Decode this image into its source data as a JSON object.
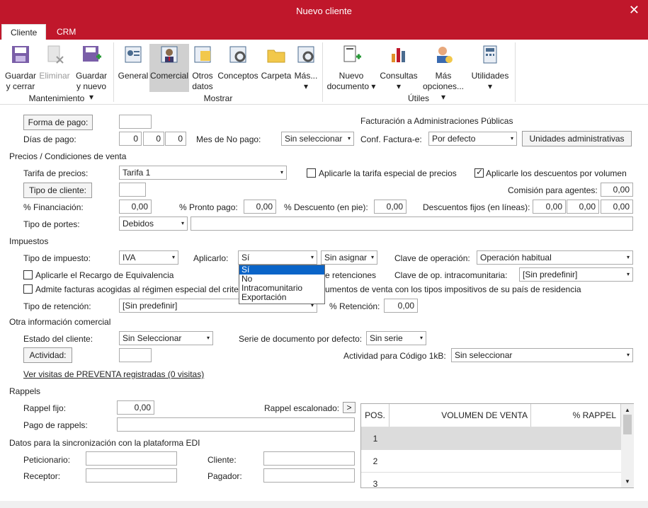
{
  "window": {
    "title": "Nuevo cliente",
    "close": "✕"
  },
  "tabs": [
    {
      "label": "Cliente"
    },
    {
      "label": "CRM"
    }
  ],
  "ribbon": {
    "mantenimiento": {
      "label": "Mantenimiento",
      "guardar_cerrar": "Guardar\ny cerrar",
      "eliminar": "Eliminar",
      "guardar_nuevo": "Guardar\ny nuevo ▾"
    },
    "mostrar": {
      "label": "Mostrar",
      "general": "General",
      "comercial": "Comercial",
      "otros_datos": "Otros\ndatos",
      "conceptos": "Conceptos",
      "carpeta": "Carpeta",
      "mas": "Más...\n▾"
    },
    "utiles": {
      "label": "Útiles",
      "nuevo_documento": "Nuevo\ndocumento ▾",
      "consultas": "Consultas\n▾",
      "mas_opciones": "Más\nopciones... ▾",
      "utilidades": "Utilidades\n▾"
    }
  },
  "pago": {
    "forma_de_pago_btn": "Forma de pago:",
    "forma_de_pago_value": "",
    "dias_de_pago_label": "Días de pago:",
    "dias": [
      "0",
      "0",
      "0"
    ],
    "mes_no_pago_label": "Mes de No pago:",
    "mes_no_pago_value": "Sin seleccionar",
    "facturacion_ap_label": "Facturación a Administraciones Públicas",
    "conf_factura_label": "Conf. Factura-e:",
    "conf_factura_value": "Por defecto",
    "unidades_btn": "Unidades administrativas"
  },
  "precios": {
    "section": "Precios / Condiciones de venta",
    "tarifa_label": "Tarifa de precios:",
    "tarifa_value": "Tarifa 1",
    "tarifa_especial_label": "Aplicarle la tarifa especial de precios",
    "tarifa_especial_checked": false,
    "descuentos_volumen_label": "Aplicarle los descuentos por volumen",
    "descuentos_volumen_checked": true,
    "tipo_cliente_btn": "Tipo de cliente:",
    "tipo_cliente_value": "",
    "comision_label": "Comisión para agentes:",
    "comision_value": "0,00",
    "financiacion_label": "% Financiación:",
    "financiacion_value": "0,00",
    "pronto_pago_label": "% Pronto pago:",
    "pronto_pago_value": "0,00",
    "descuento_pie_label": "% Descuento (en pie):",
    "descuento_pie_value": "0,00",
    "descuentos_fijos_label": "Descuentos fijos (en líneas):",
    "descuentos_fijos": [
      "0,00",
      "0,00",
      "0,00"
    ],
    "tipo_portes_label": "Tipo de portes:",
    "tipo_portes_value": "Debidos",
    "portes_extra": ""
  },
  "impuestos": {
    "section": "Impuestos",
    "tipo_impuesto_label": "Tipo de impuesto:",
    "tipo_impuesto_value": "IVA",
    "aplicarlo_label": "Aplicarlo:",
    "aplicarlo_value": "Sí",
    "asignar_value": "Sin asignar",
    "clave_operacion_label": "Clave de operación:",
    "clave_operacion_value": "Operación habitual",
    "recargo_label": "Aplicarle el Recargo de Equivalencia",
    "retenciones_label": "e retenciones",
    "clave_intra_label": "Clave de op. intracomunitaria:",
    "clave_intra_value": "[Sin predefinir]",
    "admite_label": "Admite facturas acogidas al régimen especial del criterio",
    "documentos_label": "umentos de venta con los tipos impositivos de su país de residencia",
    "tipo_retencion_label": "Tipo de retención:",
    "tipo_retencion_value": "[Sin predefinir]",
    "pct_retencion_label": "% Retención:",
    "pct_retencion_value": "0,00",
    "dropdown_options": [
      "Sí",
      "No",
      "Intracomunitario",
      "Exportación"
    ],
    "dropdown_selected": 0
  },
  "otra": {
    "section": "Otra información comercial",
    "estado_label": "Estado del cliente:",
    "estado_value": "Sin Seleccionar",
    "serie_label": "Serie de documento por defecto:",
    "serie_value": "Sin serie",
    "actividad_btn": "Actividad:",
    "actividad_value": "",
    "actividad_1kb_label": "Actividad para Código 1kB:",
    "actividad_1kb_value": "Sin seleccionar",
    "ver_visitas_link": "Ver visitas de PREVENTA registradas (0 visitas)"
  },
  "rappels": {
    "section": "Rappels",
    "fijo_label": "Rappel fijo:",
    "fijo_value": "0,00",
    "escalonado_label": "Rappel escalonado:",
    "escalonado_btn": ">",
    "pago_label": "Pago de rappels:",
    "pago_value": "",
    "grid_headers": [
      "POS.",
      "VOLUMEN DE VENTA",
      "% RAPPEL"
    ],
    "grid_rows": [
      "1",
      "2",
      "3"
    ]
  },
  "edi": {
    "section": "Datos para la sincronización con la plataforma EDI",
    "peticionario_label": "Peticionario:",
    "peticionario_value": "",
    "cliente_label": "Cliente:",
    "cliente_value": "",
    "receptor_label": "Receptor:",
    "receptor_value": "",
    "pagador_label": "Pagador:",
    "pagador_value": "",
    "scroll_up": "▲",
    "scroll_down": "▼",
    "dropdown_arrow": "▾",
    "icons": {
      "close": "close-icon"
    }
  }
}
